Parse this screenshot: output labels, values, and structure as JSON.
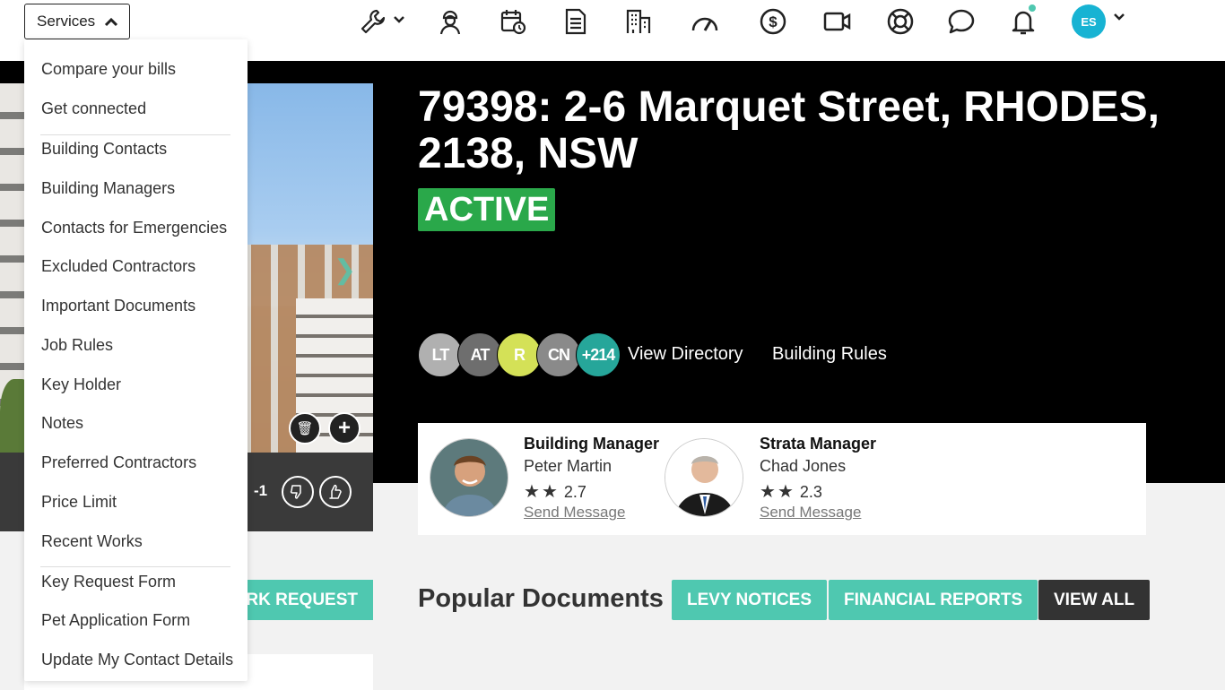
{
  "topbar": {
    "services_label": "Services",
    "icons": [
      "wrench-icon",
      "worker-icon",
      "calendar-clock-icon",
      "document-icon",
      "building-icon",
      "gauge-icon",
      "dollar-icon",
      "video-icon",
      "lifebuoy-icon",
      "chat-icon",
      "bell-icon"
    ],
    "user_initials": "ES"
  },
  "services_menu": {
    "group1": [
      "Compare your bills",
      "Get connected"
    ],
    "group2": [
      "Building Contacts",
      "Building Managers",
      "Contacts for Emergencies",
      "Excluded Contractors",
      "Important Documents",
      "Job Rules",
      "Key Holder",
      "Notes",
      "Preferred Contractors",
      "Price Limit",
      "Recent Works"
    ],
    "group3": [
      "Key Request Form",
      "Pet Application Form",
      "Update My Contact Details"
    ]
  },
  "property": {
    "title": "79398: 2-6 Marquet Street, RHODES, 2138, NSW",
    "status": "ACTIVE",
    "status_color": "#2aa84a",
    "vote_count": "-1"
  },
  "directory": {
    "avatars": [
      {
        "initials": "LT",
        "color": "#b0b0b0"
      },
      {
        "initials": "AT",
        "color": "#6e6e6e"
      },
      {
        "initials": "R",
        "color": "#d4e157"
      },
      {
        "initials": "CN",
        "color": "#8a8a8a"
      },
      {
        "initials": "+214",
        "color": "#26a69a"
      }
    ],
    "view_label": "View Directory",
    "rules_label": "Building Rules"
  },
  "managers": [
    {
      "role": "Building Manager",
      "name": "Peter Martin",
      "rating": "2.7",
      "message": "Send Message"
    },
    {
      "role": "Strata Manager",
      "name": "Chad Jones",
      "rating": "2.3",
      "message": "Send Message"
    }
  ],
  "actions": {
    "work_request_label": "ORK REQUEST"
  },
  "documents": {
    "title": "Popular Documents",
    "buttons": [
      {
        "label": "LEVY NOTICES",
        "color": "#4fc8b0"
      },
      {
        "label": "FINANCIAL REPORTS",
        "color": "#4fc8b0"
      },
      {
        "label": "VIEW ALL",
        "color": "#333333"
      }
    ]
  }
}
